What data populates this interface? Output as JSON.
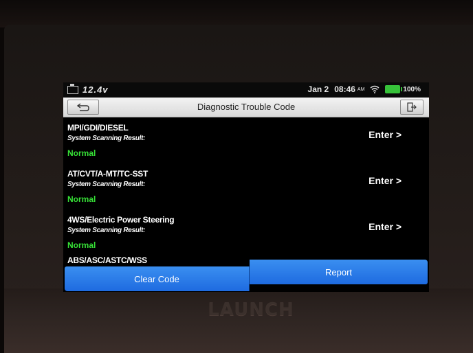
{
  "status_bar": {
    "voltage": "12.4v",
    "date": "Jan 2",
    "time": "08:46",
    "ampm": "AM",
    "battery": "100%"
  },
  "header": {
    "title": "Diagnostic Trouble Code"
  },
  "systems": [
    {
      "name": "MPI/GDI/DIESEL",
      "label": "System Scanning Result:",
      "status": "Normal",
      "action": "Enter >"
    },
    {
      "name": "AT/CVT/A-MT/TC-SST",
      "label": "System Scanning Result:",
      "status": "Normal",
      "action": "Enter >"
    },
    {
      "name": "4WS/Electric Power Steering",
      "label": "System Scanning Result:",
      "status": "Normal",
      "action": "Enter >"
    }
  ],
  "partial_row": "ABS/ASC/ASTC/WSS",
  "buttons": {
    "clear": "Clear Code",
    "report": "Report"
  },
  "brand": "LAUNCH",
  "colors": {
    "accent": "#2a7de8",
    "status_normal": "#36e036",
    "battery": "#37c23a"
  }
}
